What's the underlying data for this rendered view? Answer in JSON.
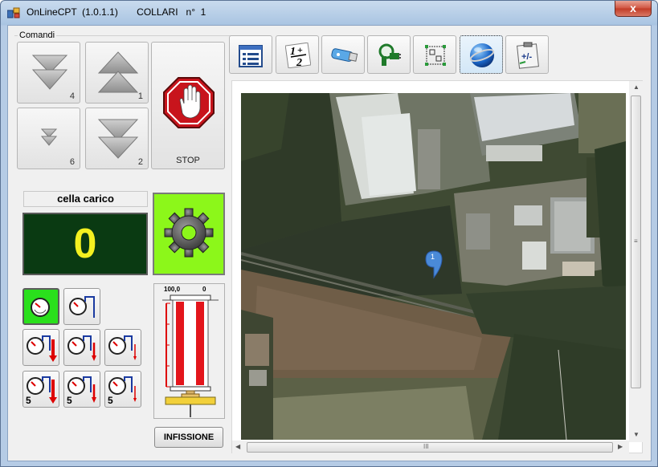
{
  "window": {
    "title": "OnLineCPT  (1.0.1.1)       COLLARI   n°  1",
    "close_label": "x"
  },
  "comandi": {
    "group_label": "Comandi",
    "buttons": [
      {
        "icon": "double-down-arrow-icon",
        "num": "4"
      },
      {
        "icon": "double-up-arrow-icon",
        "num": "1"
      },
      {
        "icon": "small-down-arrow-icon",
        "num": "6"
      },
      {
        "icon": "double-down-arrow-icon",
        "num": "2"
      }
    ],
    "stop_label": "STOP"
  },
  "cella": {
    "label": "cella carico",
    "value": "0"
  },
  "gauge_buttons": [
    {
      "badge": ""
    },
    {
      "badge": ""
    },
    {
      "badge": ""
    },
    {
      "badge": ""
    },
    {
      "badge": ""
    },
    {
      "badge": "5"
    },
    {
      "badge": "5"
    },
    {
      "badge": "5"
    }
  ],
  "cylinder": {
    "left_label": "100,0",
    "right_label": "0"
  },
  "infissione_label": "INFISSIONE",
  "toolbar": [
    "list-icon",
    "one-plus-two-icon",
    "usb-icon",
    "search-plug-icon",
    "layout-icon",
    "globe-icon",
    "clipboard-plus-minus-icon"
  ],
  "map": {
    "marker_label": "1",
    "scroll_grip": "III"
  },
  "colors": {
    "display_bg": "#0a3a12",
    "display_fg": "#f4f020",
    "active_green": "#2ae01c",
    "gear_bg": "#8cf71a"
  }
}
